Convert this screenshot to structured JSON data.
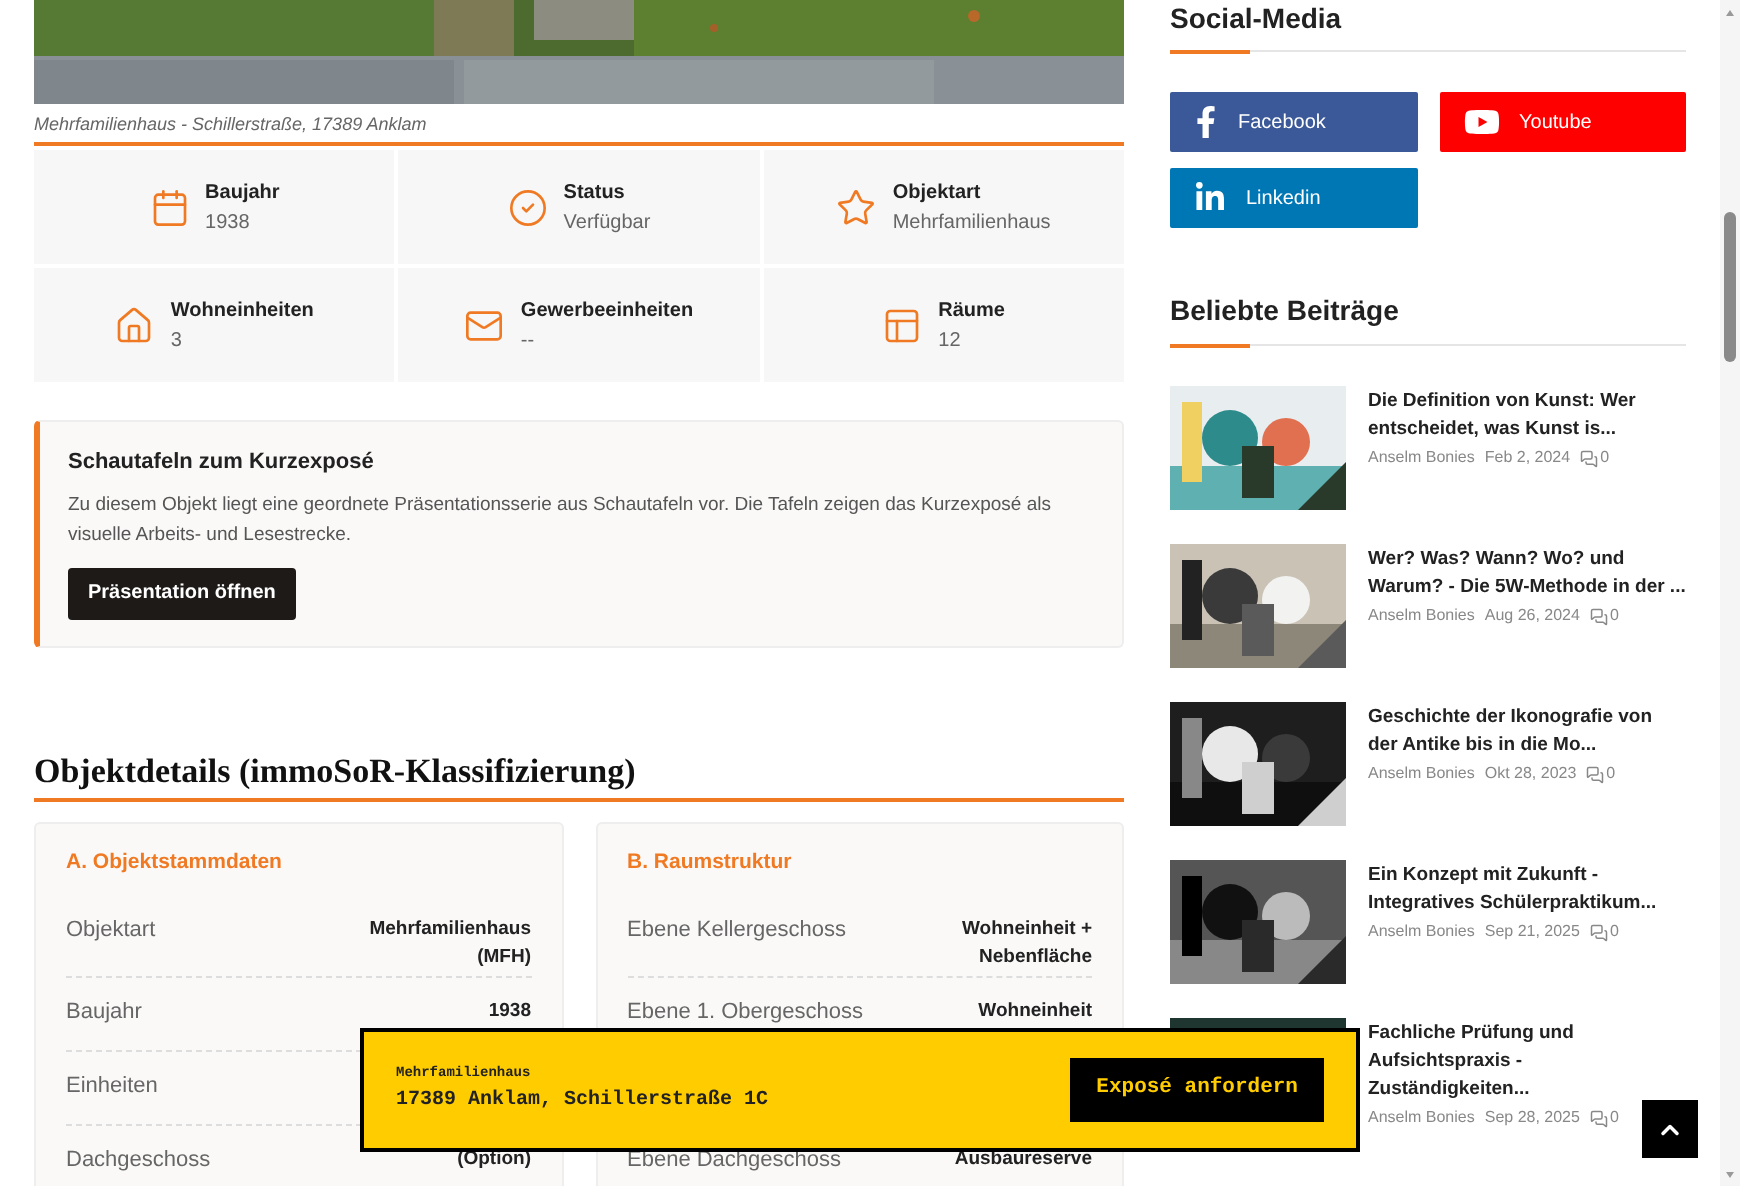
{
  "hero": {
    "caption": "Mehrfamilienhaus - Schillerstraße, 17389 Anklam"
  },
  "facts": [
    {
      "kind": "calendar",
      "label": "Baujahr",
      "value": "1938"
    },
    {
      "kind": "check",
      "label": "Status",
      "value": "Verfügbar"
    },
    {
      "kind": "star",
      "label": "Objektart",
      "value": "Mehrfamilienhaus"
    },
    {
      "kind": "house",
      "label": "Wohneinheiten",
      "value": "3"
    },
    {
      "kind": "mail",
      "label": "Gewerbeeinheiten",
      "value": "--"
    },
    {
      "kind": "layout",
      "label": "Räume",
      "value": "12"
    }
  ],
  "presentation": {
    "title": "Schautafeln zum Kurzexposé",
    "text": "Zu diesem Objekt liegt eine geordnete Präsentationsserie aus Schautafeln vor. Die Tafeln zeigen das Kurzexposé als visuelle Arbeits- und Lesestrecke.",
    "button": "Präsentation öffnen"
  },
  "details": {
    "title": "Objektdetails (immoSoR-Klassifizierung)",
    "cards": [
      {
        "title": "A. Objektstammdaten",
        "rows": [
          {
            "label": "Objektart",
            "value": "Mehrfamilienhaus (MFH)"
          },
          {
            "label": "Baujahr",
            "value": "1938"
          },
          {
            "label": "Einheiten"
          },
          {
            "label": "Dachgeschoss",
            "value": "(Option)"
          }
        ]
      },
      {
        "title": "B. Raumstruktur",
        "rows": [
          {
            "label": "Ebene Kellergeschoss",
            "value": "Wohneinheit + Nebenfläche"
          },
          {
            "label": "Ebene 1. Obergeschoss",
            "value": "Wohneinheit"
          },
          {
            "label": "Ebene Dachgeschoss",
            "value": "Ausbaureserve"
          }
        ]
      }
    ]
  },
  "sidebar": {
    "social_title": "Social-Media",
    "social": [
      {
        "kind": "facebook",
        "label": "Facebook",
        "color": "#3b5998"
      },
      {
        "kind": "youtube",
        "label": "Youtube",
        "color": "#ff0000"
      },
      {
        "kind": "linkedin",
        "label": "Linkedin",
        "color": "#0077b5"
      }
    ],
    "posts_title": "Beliebte Beiträge",
    "posts": [
      {
        "title": "Die Definition von Kunst: Wer entscheidet, was Kunst is...",
        "author": "Anselm Bonies",
        "date": "Feb 2, 2024",
        "comments": "0"
      },
      {
        "title": "Wer? Was? Wann? Wo? und Warum? - Die 5W-Methode in der ...",
        "author": "Anselm Bonies",
        "date": "Aug 26, 2024",
        "comments": "0"
      },
      {
        "title": "Geschichte der Ikonografie von der Antike bis in die Mo...",
        "author": "Anselm Bonies",
        "date": "Okt 28, 2023",
        "comments": "0"
      },
      {
        "title": "Ein Konzept mit Zukunft - Integratives Schülerpraktikum...",
        "author": "Anselm Bonies",
        "date": "Sep 21, 2025",
        "comments": "0"
      },
      {
        "title": "Fachliche Prüfung und Aufsichtspraxis - Zuständigkeiten...",
        "author": "Anselm Bonies",
        "date": "Sep 28, 2025",
        "comments": "0"
      }
    ]
  },
  "banner": {
    "type": "Mehrfamilienhaus",
    "address": "17389 Anklam, Schillerstraße 1C",
    "button": "Exposé anfordern"
  }
}
